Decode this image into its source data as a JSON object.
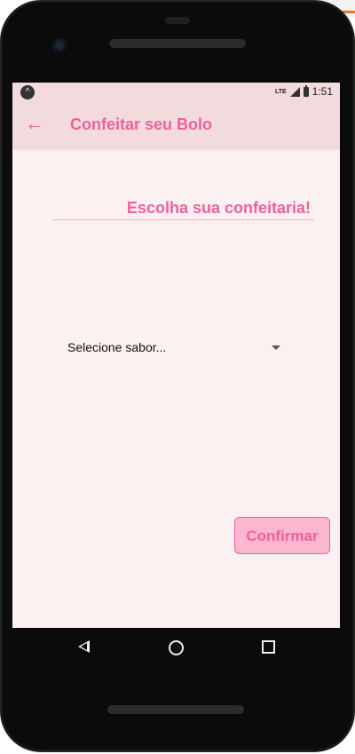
{
  "status_bar": {
    "network": "LTE",
    "time": "1:51"
  },
  "app_bar": {
    "back_icon": "arrow-left-icon",
    "title": "Confeitar seu Bolo"
  },
  "main": {
    "heading": "Escolha sua confeitaria!",
    "dropdown": {
      "selected": "Selecione sabor..."
    },
    "confirm_label": "Confirmar"
  },
  "colors": {
    "accent": "#f0609e",
    "app_bar_bg": "#f3dbdd",
    "screen_bg": "#fbf1f1",
    "button_bg": "#fbb7d0"
  },
  "nav_bar": {
    "icons": [
      "back-triangle-icon",
      "home-circle-icon",
      "recents-square-icon"
    ]
  }
}
